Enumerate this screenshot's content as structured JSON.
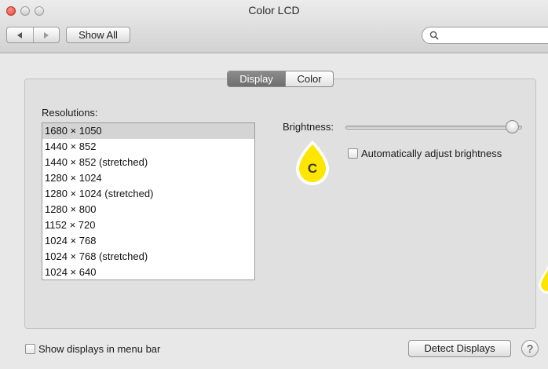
{
  "window": {
    "title": "Color LCD"
  },
  "toolbar": {
    "show_all_label": "Show All",
    "search_value": "",
    "search_placeholder": ""
  },
  "tabs": [
    {
      "label": "Display",
      "selected": true
    },
    {
      "label": "Color",
      "selected": false
    }
  ],
  "resolutions": {
    "label": "Resolutions:",
    "items": [
      "1680 × 1050",
      "1440 × 852",
      "1440 × 852 (stretched)",
      "1280 × 1024",
      "1280 × 1024 (stretched)",
      "1280 × 800",
      "1152 × 720",
      "1024 × 768",
      "1024 × 768 (stretched)",
      "1024 × 640"
    ],
    "selected_index": 0
  },
  "brightness": {
    "label": "Brightness:",
    "value": 0.98,
    "auto_label": "Automatically adjust brightness",
    "auto_checked": false
  },
  "footer": {
    "menu_bar_label": "Show displays in menu bar",
    "menu_bar_checked": false,
    "detect_label": "Detect Displays",
    "help_label": "?"
  },
  "annotation": {
    "marker_letter": "C",
    "marker_color": "#ffe600"
  },
  "colors": {
    "close_button": "#e2473f",
    "selected_row": "#d4d4d4",
    "active_tab": "#7a7a7a"
  }
}
